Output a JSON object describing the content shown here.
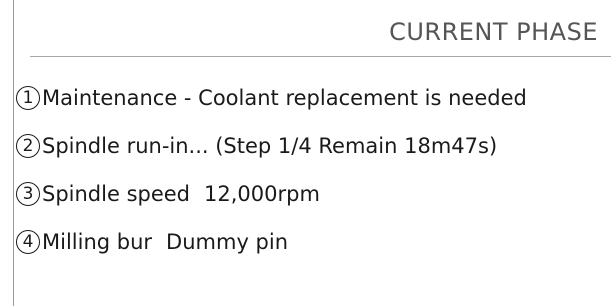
{
  "panel": {
    "title": "CURRENT PHASE",
    "rows": [
      {
        "number": "1",
        "text": "Maintenance - Coolant replacement is needed",
        "value": ""
      },
      {
        "number": "2",
        "text": "Spindle run-in... (Step 1/4 Remain 18m47s)",
        "value": ""
      },
      {
        "number": "3",
        "text": "Spindle speed",
        "value": "12,000rpm"
      },
      {
        "number": "4",
        "text": "Milling bur",
        "value": "Dummy pin"
      }
    ]
  }
}
